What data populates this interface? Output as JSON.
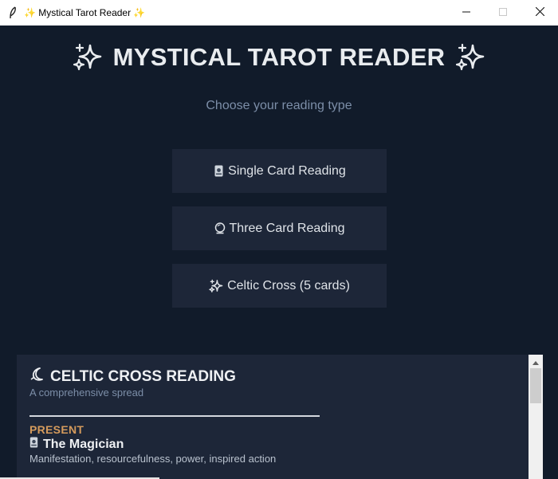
{
  "window": {
    "title": "✨ Mystical Tarot Reader ✨",
    "app_icon": "feather-icon",
    "controls": [
      "minimize-icon",
      "maximize-icon",
      "close-icon"
    ]
  },
  "header": {
    "title": "MYSTICAL TAROT READER",
    "left_icon": "sparkles-icon",
    "right_icon": "sparkles-icon",
    "subtitle": "Choose your reading type"
  },
  "menu": {
    "single": {
      "label": "Single Card Reading",
      "icon": "flower-card-icon"
    },
    "three": {
      "label": "Three Card Reading",
      "icon": "crystal-ball-icon"
    },
    "celtic": {
      "label": "Celtic Cross (5 cards)",
      "icon": "sparkles-icon"
    }
  },
  "reading": {
    "title": "CELTIC CROSS READING",
    "title_icon": "crescent-moon-icon",
    "subtitle": "A comprehensive spread",
    "positions": [
      {
        "label": "PRESENT",
        "card_icon": "flower-card-icon",
        "card_name": "The Magician",
        "meaning": "Manifestation, resourcefulness, power, inspired action"
      }
    ]
  },
  "colors": {
    "background": "#111b2a",
    "button_bg": "#1d2638",
    "heading": "#e9ecef",
    "subtitle": "#7c8ea8",
    "position_label": "#d49a5c"
  }
}
